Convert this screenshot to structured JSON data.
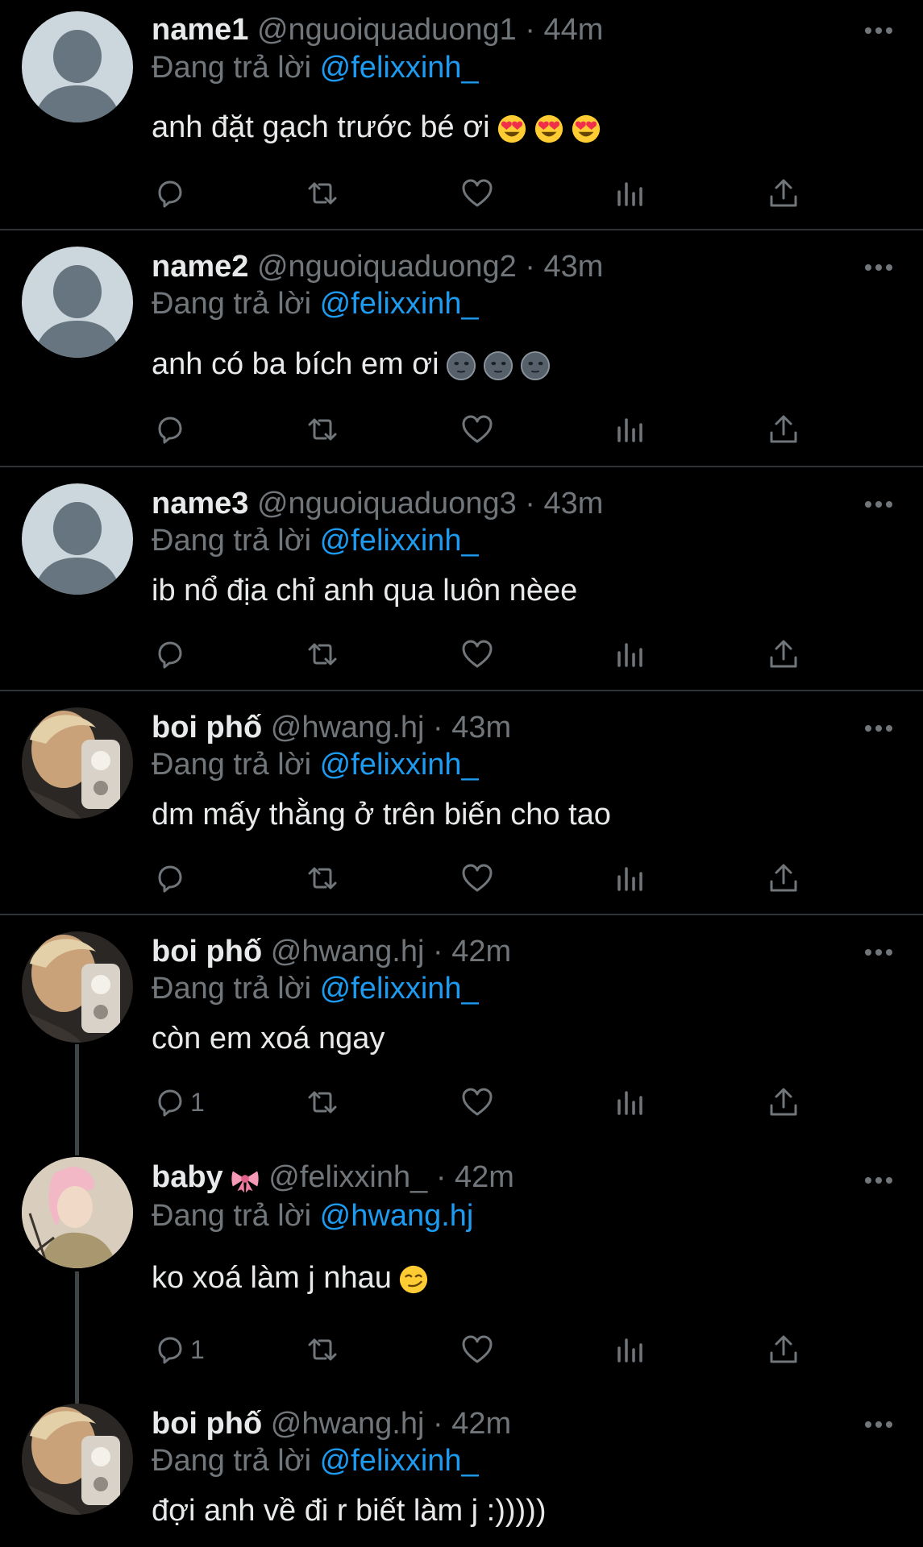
{
  "colors": {
    "background": "#000000",
    "divider": "#2f3336",
    "text": "#e7e9ea",
    "muted": "#71767b",
    "mention": "#1d9bf0"
  },
  "tweets": [
    {
      "name": "name1",
      "handle": "@nguoiquaduong1",
      "time": "· 44m",
      "reply_prefix": "Đang trả lời",
      "reply_to": "@felixxinh_",
      "text": "anh đặt gạch trước bé ơi",
      "emojis": [
        "heart-eyes-emoji",
        "heart-eyes-emoji",
        "heart-eyes-emoji"
      ],
      "avatar": "default-avatar",
      "reply_count": ""
    },
    {
      "name": "name2",
      "handle": "@nguoiquaduong2",
      "time": "· 43m",
      "reply_prefix": "Đang trả lời",
      "reply_to": "@felixxinh_",
      "text": "anh có ba bích em ơi",
      "emojis": [
        "new-moon-face-emoji",
        "new-moon-face-emoji",
        "new-moon-face-emoji"
      ],
      "avatar": "default-avatar",
      "reply_count": ""
    },
    {
      "name": "name3",
      "handle": "@nguoiquaduong3",
      "time": "· 43m",
      "reply_prefix": "Đang trả lời",
      "reply_to": "@felixxinh_",
      "text": "ib nổ địa chỉ anh qua luôn nèee",
      "emojis": [],
      "avatar": "default-avatar",
      "reply_count": ""
    },
    {
      "name": "boi phố",
      "handle": "@hwang.hj",
      "time": "· 43m",
      "reply_prefix": "Đang trả lời",
      "reply_to": "@felixxinh_",
      "text": "dm mấy thằng ở trên biến cho tao",
      "emojis": [],
      "avatar": "photo-avatar-boi",
      "reply_count": ""
    },
    {
      "name": "boi phố",
      "handle": "@hwang.hj",
      "time": "· 42m",
      "reply_prefix": "Đang trả lời",
      "reply_to": "@felixxinh_",
      "text": "còn em xoá ngay",
      "emojis": [],
      "avatar": "photo-avatar-boi",
      "reply_count": "1"
    },
    {
      "name": "baby",
      "name_emoji": "ribbon-emoji",
      "handle": "@felixxinh_",
      "time": "· 42m",
      "reply_prefix": "Đang trả lời",
      "reply_to": "@hwang.hj",
      "text": "ko xoá làm j nhau",
      "emojis": [
        "smirk-emoji"
      ],
      "avatar": "photo-avatar-baby",
      "reply_count": "1"
    },
    {
      "name": "boi phố",
      "handle": "@hwang.hj",
      "time": "· 42m",
      "reply_prefix": "Đang trả lời",
      "reply_to": "@felixxinh_",
      "text": "đợi anh về đi r biết làm j :)))))",
      "emojis": [],
      "avatar": "photo-avatar-boi",
      "reply_count": ""
    }
  ]
}
